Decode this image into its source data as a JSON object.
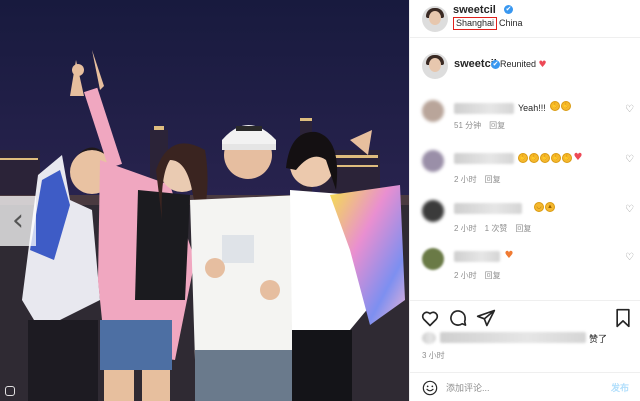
{
  "post": {
    "username": "sweetcil",
    "verified_mark": "✔",
    "location_city": "Shanghai",
    "location_country": "China",
    "caption_text": "Reunited",
    "caption_heart": "♥",
    "highlight_color": "#e0201b",
    "accent_color": "#3897f0"
  },
  "comments": [
    {
      "text": "Yeah!!!",
      "emojis": [
        "clap",
        "clap"
      ],
      "time": "51 分钟",
      "reply": "回复",
      "likes": "",
      "avatar_color": "#b9a59a"
    },
    {
      "text": "",
      "emojis": [
        "clap",
        "clap",
        "clap",
        "clap",
        "clap",
        "heart"
      ],
      "time": "2 小时",
      "reply": "回复",
      "likes": "",
      "avatar_color": "#9a8fa8"
    },
    {
      "text": "",
      "emojis": [
        "smile",
        "thumbs"
      ],
      "time": "2 小时",
      "reply": "回复",
      "likes": "1 次赞",
      "avatar_color": "#3b3b3b"
    },
    {
      "text": "",
      "emojis": [
        "heart"
      ],
      "time": "2 小时",
      "reply": "回复",
      "likes": "",
      "avatar_color": "#6a7a46"
    }
  ],
  "like_icon": "♡",
  "likes": {
    "suffix": "赞了"
  },
  "time_ago": "3 小时",
  "composer": {
    "placeholder": "添加评论...",
    "post_label": "发布"
  },
  "icons": [
    "heart-icon",
    "comment-icon",
    "share-icon",
    "bookmark-icon",
    "smile-icon",
    "chevron-left-icon"
  ]
}
